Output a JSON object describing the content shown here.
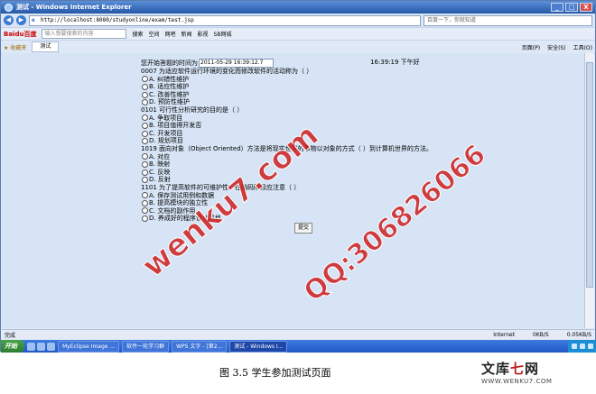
{
  "window": {
    "title": "测试 - Windows Internet Explorer",
    "controls": [
      "_",
      "□",
      "X"
    ]
  },
  "address_bar": {
    "url": "http://localhost:8080/studyonline/exam/test.jsp",
    "search_placeholder": "百度一下，你就知道"
  },
  "toolbar": {
    "logo": "Baidu百度",
    "search_placeholder": "输入想要搜索的内容",
    "items": [
      "搜索",
      "空间",
      "网吧",
      "新闻",
      "影视",
      "SB网城"
    ]
  },
  "tabs": {
    "favorites": "收藏夹",
    "current": "测试",
    "commands": [
      "页面(P)",
      "安全(S)",
      "工具(O)"
    ]
  },
  "quiz": {
    "start_label": "您开始答题的时间为",
    "start_time": "2011-05-29 16:39:12.7",
    "clock": "16:39:19  下午好",
    "submit_label": "提交",
    "questions": [
      {
        "text": "0007 为适应软件运行环境的变化而修改软件的活动称为（ ）",
        "options": [
          "A. 纠错性维护",
          "B. 适应性维护",
          "C. 改善性维护",
          "D. 预防性维护"
        ]
      },
      {
        "text": "0101 可行性分析研究的目的是（ ）",
        "options": [
          "A. 争取项目",
          "B. 项目值得开发否",
          "C. 开发项目",
          "D. 规划项目"
        ]
      },
      {
        "text": "1019 面向对象（Object Oriented）方法是将现实世界的事物以对象的方式（ ）到计算机世界的方法。",
        "options": [
          "A. 对应",
          "B. 映射",
          "C. 反映",
          "D. 反射"
        ]
      },
      {
        "text": "1101 为了提高软件的可维护性，在编码阶段应注意（ ）",
        "options": [
          "A. 保存测试用例和数据",
          "B. 提高模块的独立性",
          "C. 文档的副作用",
          "D. 养成好的程序设计风格"
        ]
      }
    ]
  },
  "status": {
    "left": "完成",
    "zone": "Internet",
    "speed_up": "0KB/S",
    "speed_down": "0.05KB/S"
  },
  "taskbar": {
    "start": "开始",
    "tasks": [
      "MyEclipse Image ...",
      "软件一轮学习群",
      "WPS 文字 - [第2...",
      "测试 - Windows I..."
    ]
  },
  "caption": "图 3.5 学生参加测试页面",
  "brand": {
    "name_prefix": "文库",
    "name_seven": "七",
    "name_suffix": "网",
    "url": "WWW.WENKU7.COM"
  },
  "watermarks": [
    "wenku7.com",
    "QQ:306826066"
  ]
}
